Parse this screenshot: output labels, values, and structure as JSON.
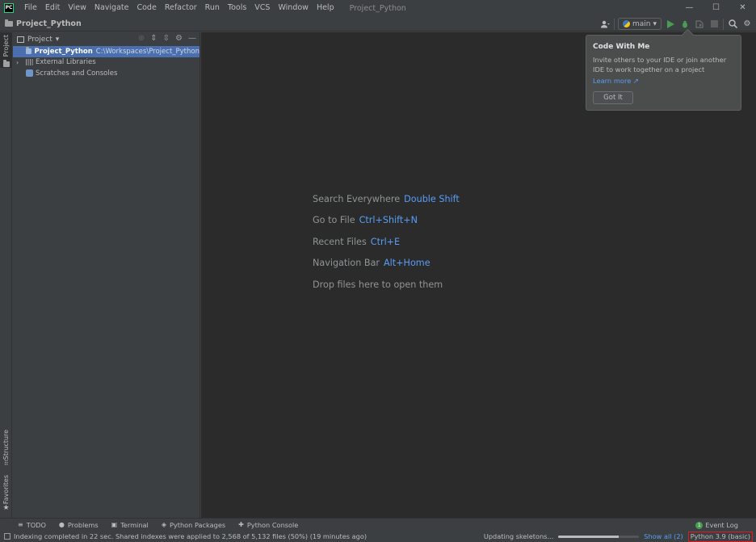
{
  "menubar": {
    "logo": "PC",
    "items": [
      "File",
      "Edit",
      "View",
      "Navigate",
      "Code",
      "Refactor",
      "Run",
      "Tools",
      "VCS",
      "Window",
      "Help"
    ],
    "project_title": "Project_Python",
    "window_controls": [
      "—",
      "☐",
      "✕"
    ]
  },
  "navbar": {
    "breadcrumb": "Project_Python",
    "branch": "main",
    "icons": [
      "user-icon",
      "run-icon",
      "debug-icon",
      "coverage-icon",
      "stop-icon",
      "search-icon",
      "gear-icon"
    ]
  },
  "left_strip": {
    "project": "Project",
    "structure": "Structure",
    "favorites": "Favorites"
  },
  "project_panel": {
    "title": "Project",
    "tree": [
      {
        "label": "Project_Python",
        "path": "C:\\Workspaces\\Project_Python",
        "selected": true
      },
      {
        "label": "External Libraries"
      },
      {
        "label": "Scratches and Consoles"
      }
    ]
  },
  "editor": {
    "hints": [
      {
        "text": "Search Everywhere",
        "key": "Double Shift"
      },
      {
        "text": "Go to File",
        "key": "Ctrl+Shift+N"
      },
      {
        "text": "Recent Files",
        "key": "Ctrl+E"
      },
      {
        "text": "Navigation Bar",
        "key": "Alt+Home"
      },
      {
        "text": "Drop files here to open them",
        "key": ""
      }
    ]
  },
  "popup": {
    "title": "Code With Me",
    "body": "Invite others to your IDE or join another IDE to work together on a project",
    "link": "Learn more ↗",
    "button": "Got It"
  },
  "bottom_bar": {
    "tabs": [
      {
        "icon": "todo-icon",
        "glyph": "≡",
        "label": "TODO"
      },
      {
        "icon": "problems-icon",
        "glyph": "●",
        "label": "Problems"
      },
      {
        "icon": "terminal-icon",
        "glyph": "▣",
        "label": "Terminal"
      },
      {
        "icon": "python-packages-icon",
        "glyph": "◈",
        "label": "Python Packages"
      },
      {
        "icon": "python-console-icon",
        "glyph": "✚",
        "label": "Python Console"
      }
    ],
    "event_log": "Event Log",
    "event_count": "1"
  },
  "status_bar": {
    "message": "Indexing completed in 22 sec. Shared indexes were applied to 2,568 of 5,132 files (50%) (19 minutes ago)",
    "task": "Updating skeletons...",
    "progress": 0.75,
    "show_all": "Show all (2)",
    "interpreter": "Python 3.9 (basic)"
  },
  "colors": {
    "accent": "#589df6",
    "selection": "#4b6eaf",
    "highlight_border": "#e01b1b"
  }
}
